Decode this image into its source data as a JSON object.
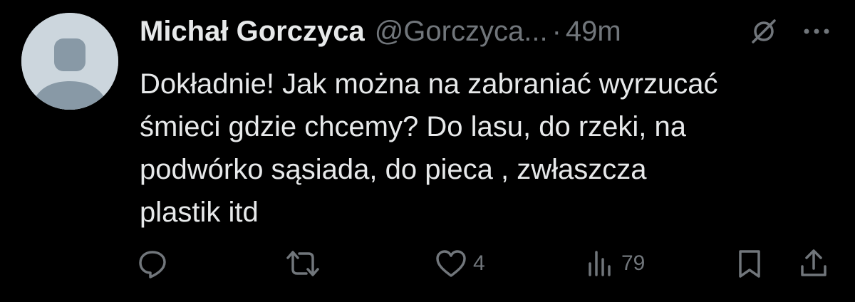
{
  "author": {
    "display_name": "Michał Gorczyca",
    "handle": "@Gorczyca...",
    "separator": "·",
    "timestamp": "49m"
  },
  "tweet": {
    "lines": [
      "Dokładnie! Jak można na zabraniać wyrzucać",
      "śmieci gdzie chcemy? Do lasu, do rzeki, na",
      "podwórko sąsiada, do pieca , zwłaszcza",
      "plastik itd"
    ]
  },
  "actions": {
    "reply_icon": "reply-icon",
    "retweet_icon": "retweet-icon",
    "like_icon": "heart-icon",
    "likes": "4",
    "views_icon": "views-icon",
    "views": "79",
    "bookmark_icon": "bookmark-icon",
    "share_icon": "share-icon"
  },
  "colors": {
    "background": "#000000",
    "text_primary": "#e7e9ea",
    "text_secondary": "#71767b",
    "avatar_bg": "#ccd6dd",
    "avatar_fg": "#8899a6"
  }
}
